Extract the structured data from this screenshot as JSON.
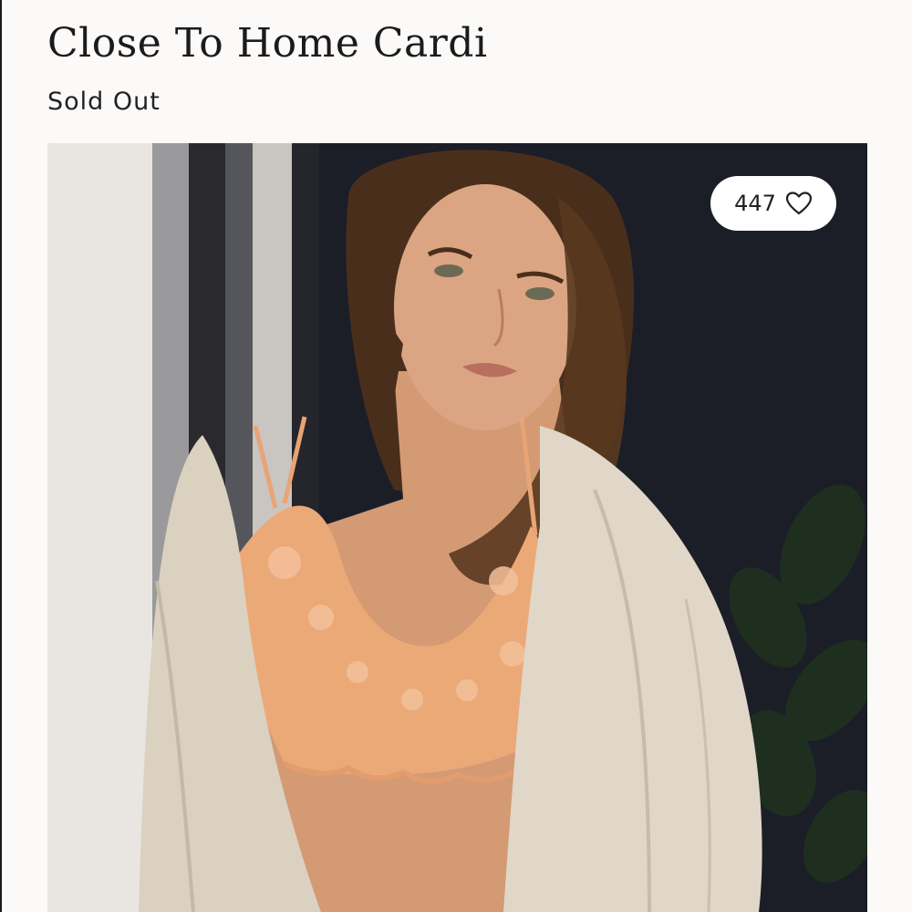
{
  "product": {
    "title": "Close To Home Cardi",
    "status": "Sold Out"
  },
  "image": {
    "alt": "Model wearing a cream cardigan over a peach lace bralette"
  },
  "likes": {
    "count": "447",
    "icon": "heart-outline-icon"
  },
  "colors": {
    "background": "#fcfaf9",
    "text": "#1b1b1b",
    "badge": "#ffffff"
  }
}
